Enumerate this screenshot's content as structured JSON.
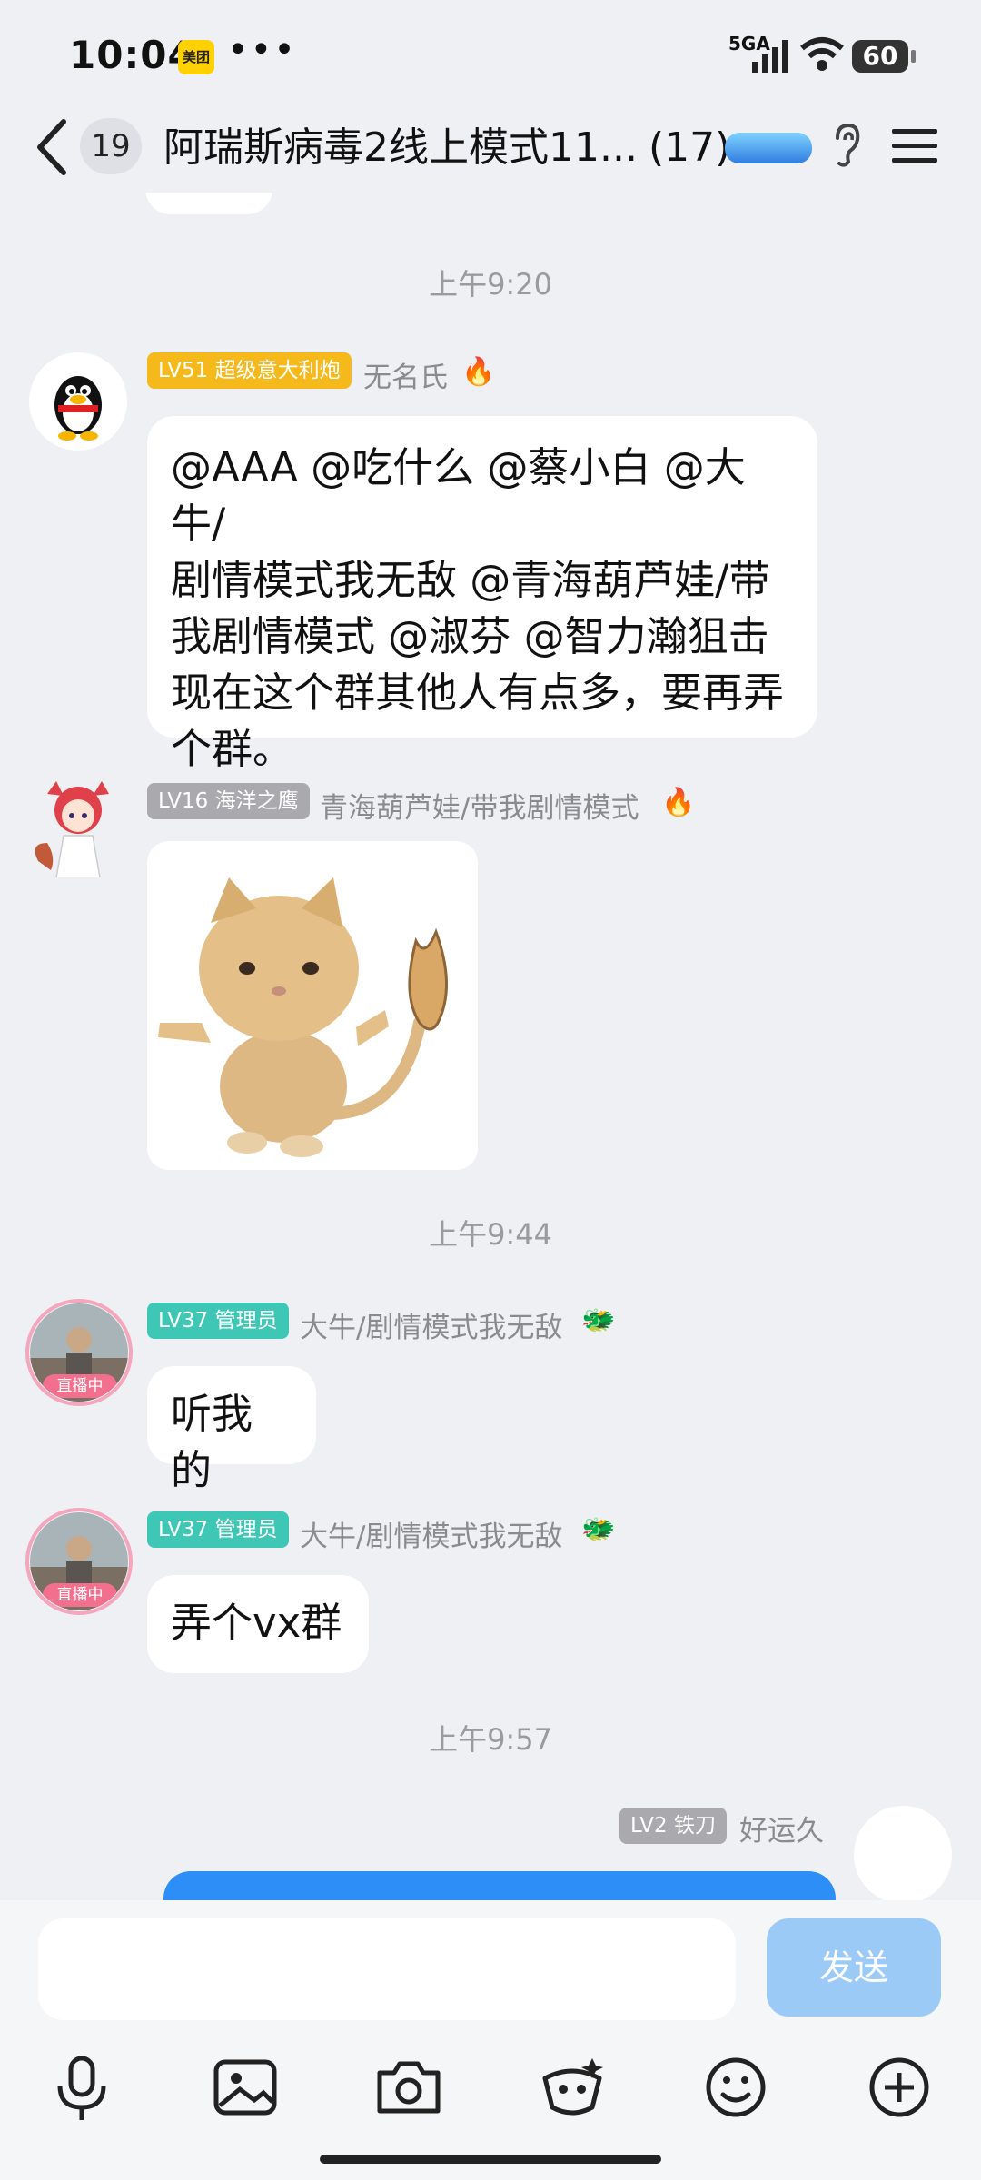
{
  "status_bar": {
    "time": "10:04",
    "app_badge": "美团",
    "more": "•••",
    "network": "5GA",
    "battery": "60"
  },
  "header": {
    "unread_count": "19",
    "title": "阿瑞斯病毒2线上模式11...",
    "member_count": "(17)"
  },
  "messages": [
    {
      "type": "timestamp",
      "text": "上午9:20"
    },
    {
      "type": "text",
      "level": "LV51 超级意大利炮",
      "level_color": "#f5b91c",
      "sender": "无名氏",
      "lines": [
        "@AAA @吃什么 @蔡小白 @大牛/",
        "剧情模式我无敌 @青海葫芦娃/带",
        "我剧情模式 @淑芬 @智力瀚狙击",
        "现在这个群其他人有点多，要再弄",
        "个群。"
      ]
    },
    {
      "type": "sticker",
      "level": "LV16 海洋之鹰",
      "level_color": "#a9a9ae",
      "sender": "青海葫芦娃/带我剧情模式"
    },
    {
      "type": "timestamp",
      "text": "上午9:44"
    },
    {
      "type": "text",
      "level": "LV37 管理员",
      "level_color": "#3ec7b4",
      "sender": "大牛/剧情模式我无敌",
      "live": "直播中",
      "lines": [
        "听我的"
      ]
    },
    {
      "type": "text",
      "level": "LV37 管理员",
      "level_color": "#3ec7b4",
      "sender": "大牛/剧情模式我无敌",
      "live": "直播中",
      "lines": [
        "弄个vx群"
      ]
    },
    {
      "type": "timestamp",
      "text": "上午9:57"
    },
    {
      "type": "self",
      "level": "LV2 铁刀",
      "level_color": "#a9a9ae",
      "sender": "好运久"
    }
  ],
  "input": {
    "send_label": "发送"
  },
  "toolbar": [
    "microphone-icon",
    "image-icon",
    "camera-icon",
    "red-packet-icon",
    "emoji-icon",
    "plus-icon"
  ]
}
